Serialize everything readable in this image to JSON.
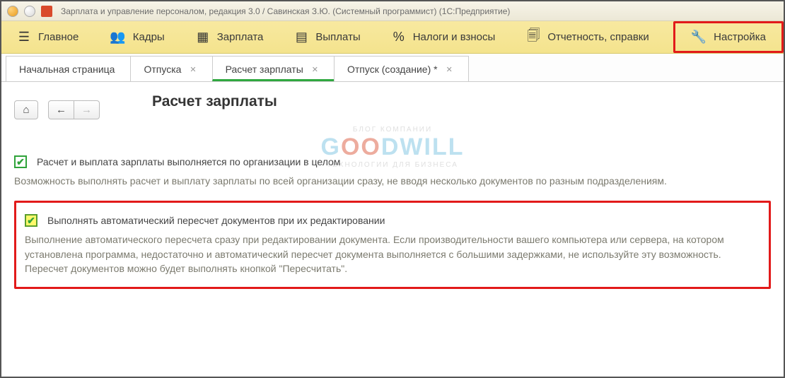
{
  "window": {
    "title": "Зарплата и управление персоналом, редакция 3.0 / Савинская З.Ю. (Системный программист)  (1С:Предприятие)"
  },
  "menu": {
    "items": [
      {
        "icon": "☰",
        "label": "Главное"
      },
      {
        "icon": "👥",
        "label": "Кадры"
      },
      {
        "icon": "▦",
        "label": "Зарплата"
      },
      {
        "icon": "▤",
        "label": "Выплаты"
      },
      {
        "icon": "%",
        "label": "Налоги и взносы"
      },
      {
        "icon": "🗐",
        "label": "Отчетность, справки"
      },
      {
        "icon": "🔧",
        "label": "Настройка"
      }
    ]
  },
  "tabs": {
    "items": [
      {
        "label": "Начальная страница",
        "closable": false
      },
      {
        "label": "Отпуска",
        "closable": true
      },
      {
        "label": "Расчет зарплаты",
        "closable": true,
        "active": true
      },
      {
        "label": "Отпуск (создание) *",
        "closable": true
      }
    ]
  },
  "page": {
    "title": "Расчет зарплаты",
    "toolbar": {
      "home": "⌂",
      "back": "←",
      "forward": "→"
    },
    "option1": {
      "label": "Расчет и выплата зарплаты выполняется по организации в целом",
      "desc": "Возможность выполнять расчет и выплату зарплаты по всей организации сразу, не вводя несколько документов по разным подразделениям."
    },
    "option2": {
      "label": "Выполнять автоматический пересчет документов при их редактировании",
      "desc": "Выполнение автоматического пересчета сразу при редактировании документа. Если производительности вашего компьютера или сервера, на котором установлена программа, недостаточно и автоматический пересчет документа выполняется с большими задержками, не используйте эту возможность. Пересчет документов можно будет выполнять кнопкой \"Пересчитать\"."
    }
  },
  "watermark": {
    "top": "БЛОГ КОМПАНИИ",
    "mid_g": "G",
    "mid_red": "OO",
    "mid_rest": "DWILL",
    "bot": "ТЕХНОЛОГИИ ДЛЯ БИЗНЕСА"
  }
}
